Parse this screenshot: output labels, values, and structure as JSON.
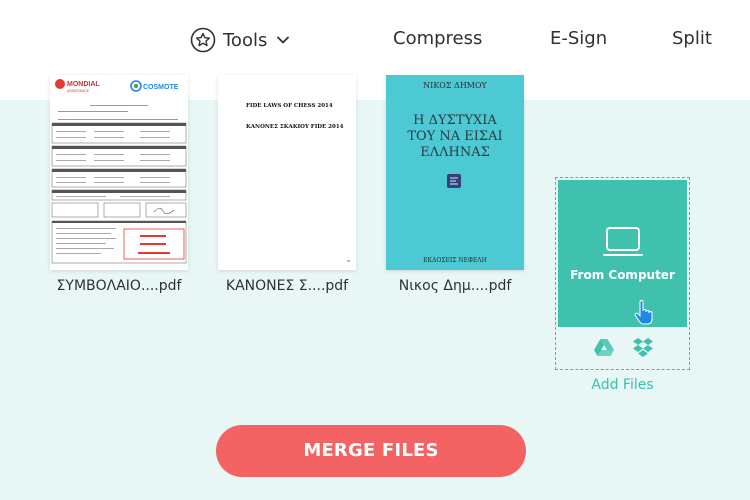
{
  "header": {
    "tools_label": "Tools",
    "nav_links": [
      "Compress",
      "E-Sign",
      "Split"
    ]
  },
  "files": [
    {
      "name": "ΣΥΜΒΟΛΑΙΟ....pdf",
      "thumb_logo_left": "MONDIAL",
      "thumb_logo_left_sub": "ASSISTANCE",
      "thumb_logo_right": "COSMOTE"
    },
    {
      "name": "ΚΑΝΟΝΕΣ Σ....pdf",
      "thumb_line1": "FIDE LAWS OF CHESS 2014",
      "thumb_line2": "ΚΑΝΟΝΕΣ ΣΚΑΚΙΟΥ FIDE 2014"
    },
    {
      "name": "Νικος Δημ....pdf",
      "cover_author": "ΝΙΚΟΣ ΔΗΜΟΥ",
      "cover_title_lines": [
        "Η ΔΥΣΤΥΧΙΑ",
        "ΤΟΥ ΝΑ ΕΙΣΑΙ",
        "ΕΛΛΗΝΑΣ"
      ],
      "cover_publisher": "ΕΚΔΟΣΕΙΣ ΝΕΦΕΛΗ"
    }
  ],
  "add_card": {
    "from_computer": "From Computer",
    "add_files": "Add Files"
  },
  "merge_button": "MERGE FILES",
  "colors": {
    "workarea_bg": "#e8f6f5",
    "accent_teal": "#3fc1ae",
    "merge_red": "#f46363",
    "cover_cyan": "#4cc9d2"
  }
}
